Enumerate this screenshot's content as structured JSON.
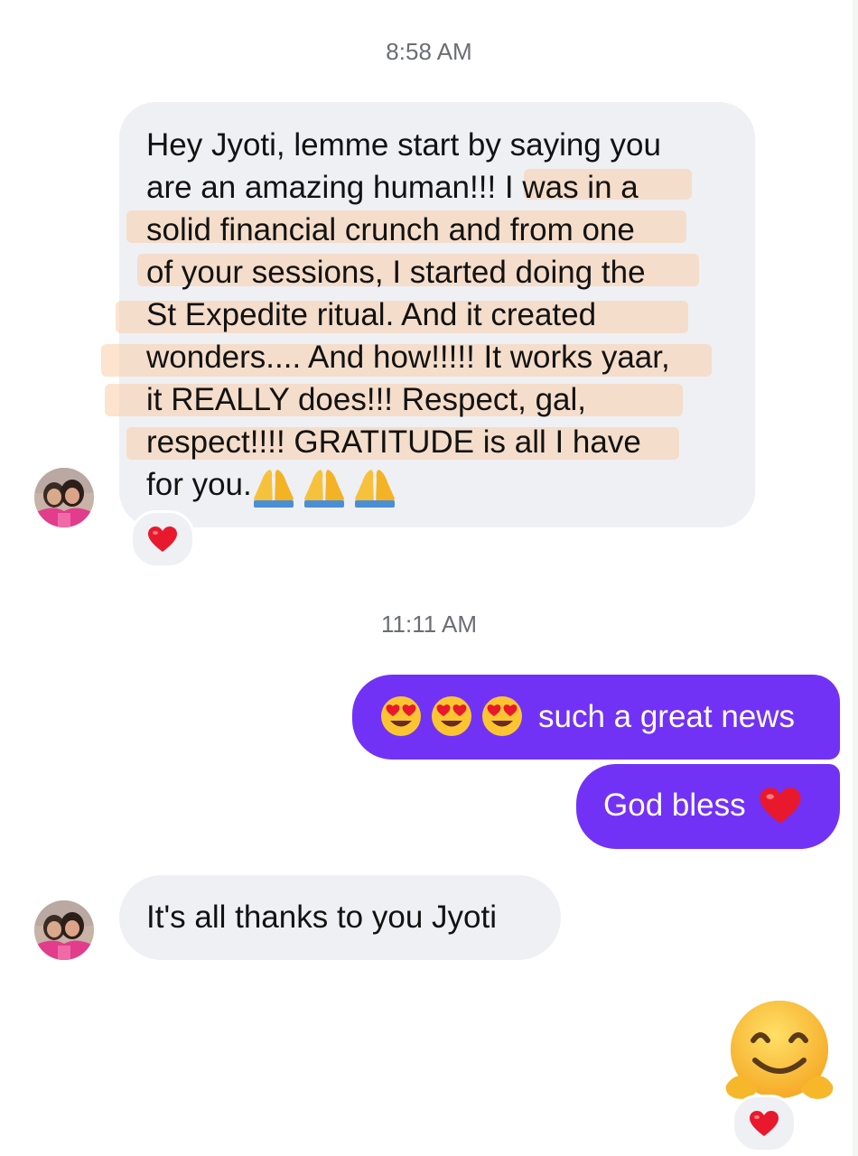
{
  "conversation": {
    "messages": [
      {
        "timestamp": "8:58 AM",
        "sender": "incoming",
        "lines": [
          "Hey Jyoti, lemme start by saying you",
          "are an amazing human!!! I was in a",
          "solid financial crunch and from one",
          "of your sessions, I started doing the",
          "St Expedite ritual. And it created",
          "wonders.... And how!!!!! It works yaar,",
          "it REALLY does!!! Respect, gal,",
          "respect!!!! GRATITUDE is all I have",
          "for you."
        ],
        "trailing_emoji": "folded-hands-icon x3",
        "reaction": "red-heart-icon"
      },
      {
        "timestamp": "11:11 AM",
        "sender": "outgoing",
        "text": "such a great news",
        "leading_emoji": "heart-eyes-icon x3"
      },
      {
        "sender": "outgoing",
        "text": "God bless",
        "trailing_emoji": "red-heart-icon"
      },
      {
        "sender": "incoming",
        "text": "It's all thanks to you Jyoti"
      },
      {
        "sender": "outgoing",
        "emoji": "hugging-face-icon",
        "reaction": "red-heart-icon"
      }
    ]
  },
  "colors": {
    "incoming_bubble": "#eef0f4",
    "outgoing_bubble": "#7232f6",
    "timestamp_text": "#6b6e73",
    "highlight": "#face a8"
  }
}
